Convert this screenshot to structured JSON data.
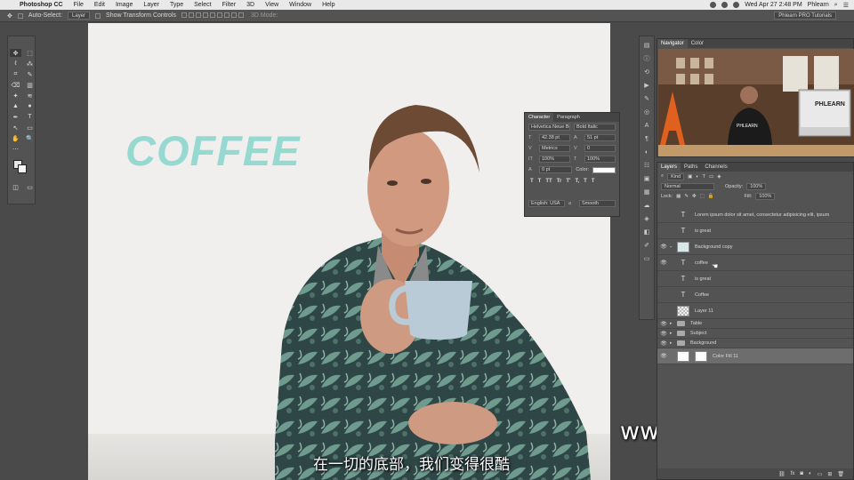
{
  "menubar": {
    "app_name": "Photoshop CC",
    "items": [
      "File",
      "Edit",
      "Image",
      "Layer",
      "Type",
      "Select",
      "Filter",
      "3D",
      "View",
      "Window",
      "Help"
    ],
    "datetime": "Wed Apr 27 2:48 PM",
    "user": "Phlearn"
  },
  "options_bar": {
    "auto_select_label": "Auto-Select:",
    "auto_select_value": "Layer",
    "transform_label": "Show Transform Controls",
    "mode_3d": "3D Mode:",
    "workspace": "Phlearn PRO Tutorials"
  },
  "tools": [
    "✥",
    "⬚",
    "ℓ",
    "⁂",
    "⌗",
    "✎",
    "⌫",
    "▥",
    "✦",
    "≋",
    "▲",
    "●",
    "✒",
    "T",
    "↖",
    "▭",
    "✋",
    "🔍",
    "⋯",
    ""
  ],
  "canvas": {
    "headline": "COFFEE",
    "subtitle": "在一切的底部，我们变得很酷",
    "watermark": "www.hunls.com",
    "colors": {
      "headline": "#8fd8cf",
      "background": "#f0efed",
      "jacket": "#2f4a4a",
      "mug": "#b9c9d6"
    }
  },
  "character_panel": {
    "tabs": [
      "Character",
      "Paragraph"
    ],
    "font_family": "Helvetica Neue Bol...",
    "font_style": "Bold Italic",
    "font_size": "42.38 pt",
    "leading": "51 pt",
    "kerning": "Metrics",
    "tracking": "0",
    "vertical_scale": "100%",
    "horizontal_scale": "100%",
    "baseline_shift": "0 pt",
    "color_label": "Color:",
    "style_buttons": [
      "T",
      "T",
      "TT",
      "Tr",
      "T'",
      "T,",
      "T",
      "T"
    ],
    "language": "English: USA",
    "antialias": "Smooth"
  },
  "navigator_panel": {
    "tabs": [
      "Navigator",
      "Color"
    ],
    "sign_text": "PHLEARN",
    "shirt_text": "PHLEARN"
  },
  "layers_panel": {
    "tabs": [
      "Layers",
      "Paths",
      "Channels"
    ],
    "filter_kind": "Kind",
    "blend_mode": "Normal",
    "opacity_label": "Opacity:",
    "opacity": "100%",
    "lock_label": "Lock:",
    "fill_label": "Fill:",
    "fill": "100%",
    "layers": [
      {
        "name": "Lorem ipsum dolor sit amet, consectetur adipisicing elit, ipsum",
        "type": "text",
        "visible": false
      },
      {
        "name": "is great",
        "type": "text",
        "visible": false
      },
      {
        "name": "Background copy",
        "type": "image",
        "visible": true
      },
      {
        "name": "coffee",
        "type": "text",
        "visible": true
      },
      {
        "name": "is great",
        "type": "text",
        "visible": false
      },
      {
        "name": "Coffee",
        "type": "text",
        "visible": false
      },
      {
        "name": "Layer 11",
        "type": "checker",
        "visible": false
      },
      {
        "name": "Table",
        "type": "folder",
        "visible": true
      },
      {
        "name": "Subject",
        "type": "folder",
        "visible": true
      },
      {
        "name": "Background",
        "type": "folder",
        "visible": true
      },
      {
        "name": "Color Fill 11",
        "type": "fill",
        "visible": true
      }
    ]
  }
}
